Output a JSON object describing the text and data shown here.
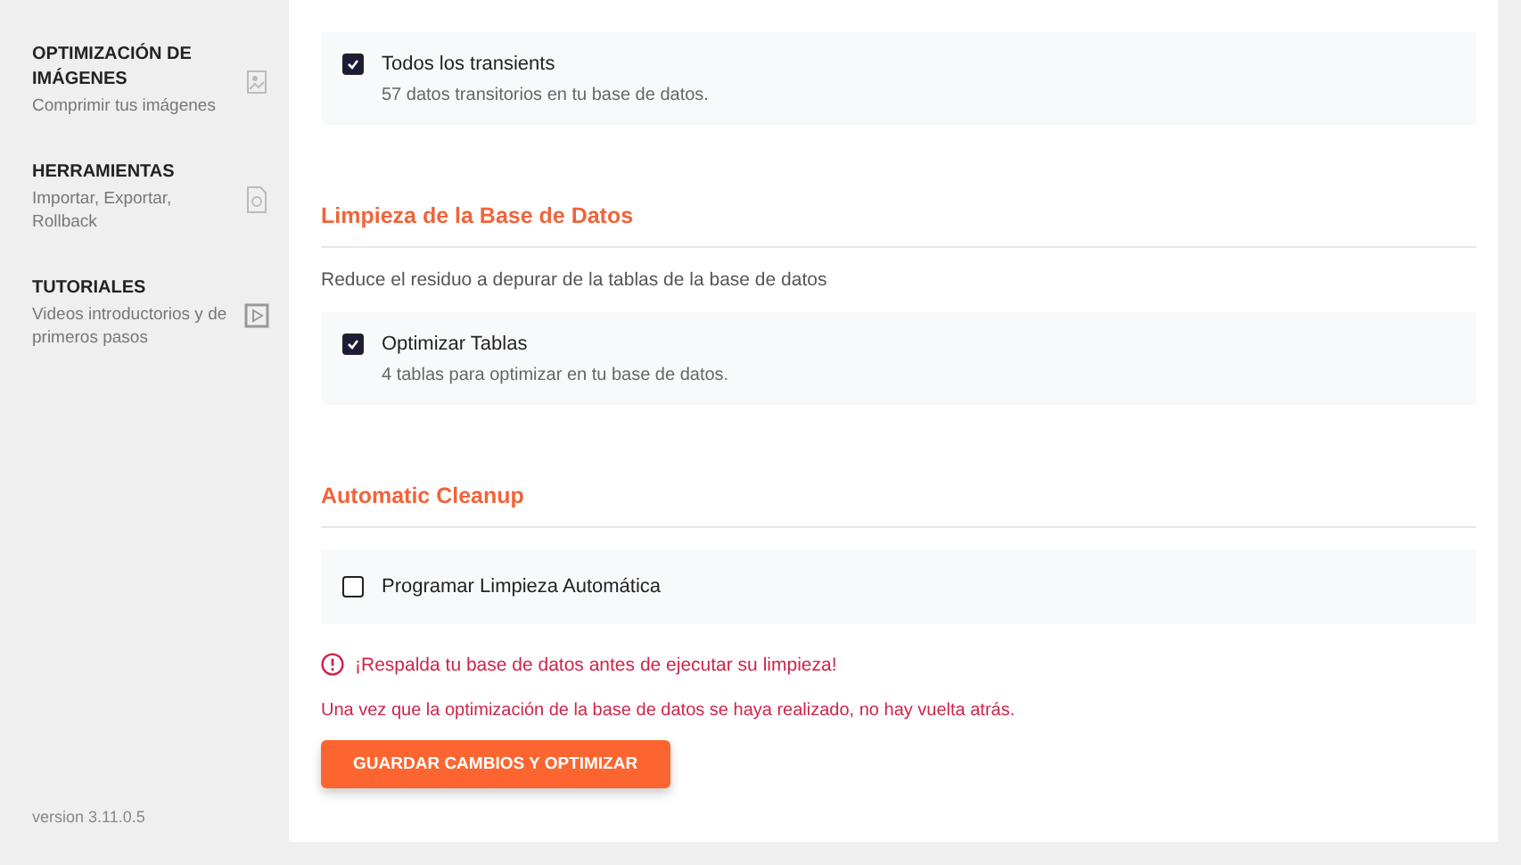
{
  "sidebar": {
    "items": [
      {
        "title": "OPTIMIZACIÓN DE IMÁGENES",
        "subtitle": "Comprimir tus imágenes"
      },
      {
        "title": "HERRAMIENTAS",
        "subtitle": "Importar, Exportar, Rollback"
      },
      {
        "title": "TUTORIALES",
        "subtitle": "Videos introductorios y de primeros pasos"
      }
    ],
    "version": "version 3.11.0.5"
  },
  "sections": [
    {
      "options": [
        {
          "label": "Todos los transients",
          "description": "57 datos transitorios en tu base de datos.",
          "checked": true
        }
      ]
    },
    {
      "title": "Limpieza de la Base de Datos",
      "description": "Reduce el residuo a depurar de la tablas de la base de datos",
      "options": [
        {
          "label": "Optimizar Tablas",
          "description": "4 tablas para optimizar en tu base de datos.",
          "checked": true
        }
      ]
    },
    {
      "title": "Automatic Cleanup",
      "options": [
        {
          "label": "Programar Limpieza Automática",
          "checked": false
        }
      ]
    }
  ],
  "warning": "¡Respalda tu base de datos antes de ejecutar su limpieza!",
  "note": "Una vez que la optimización de la base de datos se haya realizado, no hay vuelta atrás.",
  "button": "GUARDAR CAMBIOS Y OPTIMIZAR"
}
